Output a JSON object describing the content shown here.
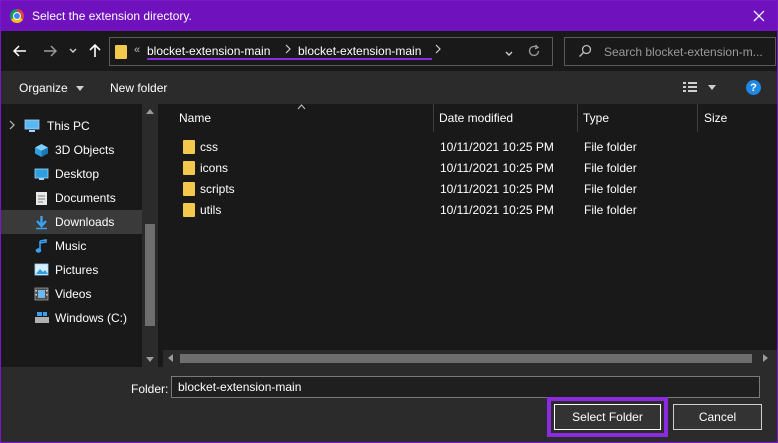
{
  "window": {
    "title": "Select the extension directory."
  },
  "address": {
    "overflow_glyph": "«",
    "crumbs": [
      "blocket-extension-main",
      "blocket-extension-main"
    ]
  },
  "search": {
    "placeholder": "Search blocket-extension-m..."
  },
  "toolbar": {
    "organize_label": "Organize",
    "new_folder_label": "New folder",
    "help_label": "?"
  },
  "nav": {
    "items": [
      {
        "label": "This PC",
        "icon": "pc-icon"
      },
      {
        "label": "3D Objects",
        "icon": "3d-objects-icon"
      },
      {
        "label": "Desktop",
        "icon": "desktop-icon"
      },
      {
        "label": "Documents",
        "icon": "documents-icon"
      },
      {
        "label": "Downloads",
        "icon": "downloads-icon",
        "selected": true
      },
      {
        "label": "Music",
        "icon": "music-icon"
      },
      {
        "label": "Pictures",
        "icon": "pictures-icon"
      },
      {
        "label": "Videos",
        "icon": "videos-icon"
      },
      {
        "label": "Windows (C:)",
        "icon": "drive-icon"
      }
    ]
  },
  "files": {
    "columns": [
      "Name",
      "Date modified",
      "Type",
      "Size"
    ],
    "rows": [
      {
        "name": "css",
        "date": "10/11/2021 10:25 PM",
        "type": "File folder",
        "size": ""
      },
      {
        "name": "icons",
        "date": "10/11/2021 10:25 PM",
        "type": "File folder",
        "size": ""
      },
      {
        "name": "scripts",
        "date": "10/11/2021 10:25 PM",
        "type": "File folder",
        "size": ""
      },
      {
        "name": "utils",
        "date": "10/11/2021 10:25 PM",
        "type": "File folder",
        "size": ""
      }
    ]
  },
  "footer": {
    "folder_label": "Folder:",
    "folder_value": "blocket-extension-main",
    "select_label": "Select Folder",
    "cancel_label": "Cancel"
  },
  "colors": {
    "title_bar": "#6f12be",
    "highlight": "#8a2be2",
    "background": "#191919",
    "folder_yellow": "#f2c94c"
  }
}
